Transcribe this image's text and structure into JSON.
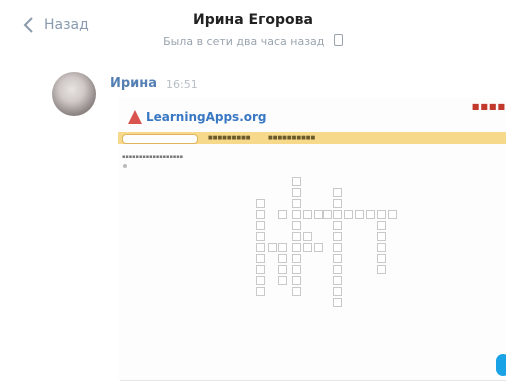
{
  "header": {
    "back_label": "Назад",
    "contact_name": "Ирина Егорова",
    "status": "Была в сети два часа назад"
  },
  "message": {
    "author": "Ирина",
    "time": "16:51"
  },
  "attachment": {
    "site_name": "LearningApps.org"
  },
  "crossword": {
    "cells": [
      [
        174,
        79
      ],
      [
        174,
        90
      ],
      [
        174,
        101
      ],
      [
        174,
        112
      ],
      [
        174,
        123
      ],
      [
        174,
        134
      ],
      [
        174,
        145
      ],
      [
        174,
        156
      ],
      [
        174,
        167
      ],
      [
        174,
        178
      ],
      [
        174,
        189
      ],
      [
        138,
        101
      ],
      [
        138,
        112
      ],
      [
        138,
        123
      ],
      [
        138,
        134
      ],
      [
        138,
        145
      ],
      [
        138,
        156
      ],
      [
        138,
        167
      ],
      [
        138,
        178
      ],
      [
        138,
        189
      ],
      [
        215,
        90
      ],
      [
        215,
        101
      ],
      [
        215,
        112
      ],
      [
        215,
        123
      ],
      [
        215,
        134
      ],
      [
        215,
        145
      ],
      [
        215,
        156
      ],
      [
        215,
        167
      ],
      [
        215,
        178
      ],
      [
        215,
        189
      ],
      [
        215,
        200
      ],
      [
        160,
        112
      ],
      [
        185,
        112
      ],
      [
        196,
        112
      ],
      [
        205,
        112
      ],
      [
        226,
        112
      ],
      [
        237,
        112
      ],
      [
        248,
        112
      ],
      [
        259,
        112
      ],
      [
        270,
        112
      ],
      [
        259,
        123
      ],
      [
        259,
        134
      ],
      [
        259,
        145
      ],
      [
        259,
        156
      ],
      [
        259,
        167
      ],
      [
        150,
        145
      ],
      [
        160,
        145
      ],
      [
        185,
        145
      ],
      [
        196,
        145
      ],
      [
        160,
        156
      ],
      [
        160,
        167
      ],
      [
        160,
        178
      ],
      [
        185,
        134
      ]
    ]
  },
  "colors": {
    "link_blue": "#5580b4",
    "la_orange_bar": "#f6d98a",
    "fab_blue": "#1aa2e6"
  }
}
